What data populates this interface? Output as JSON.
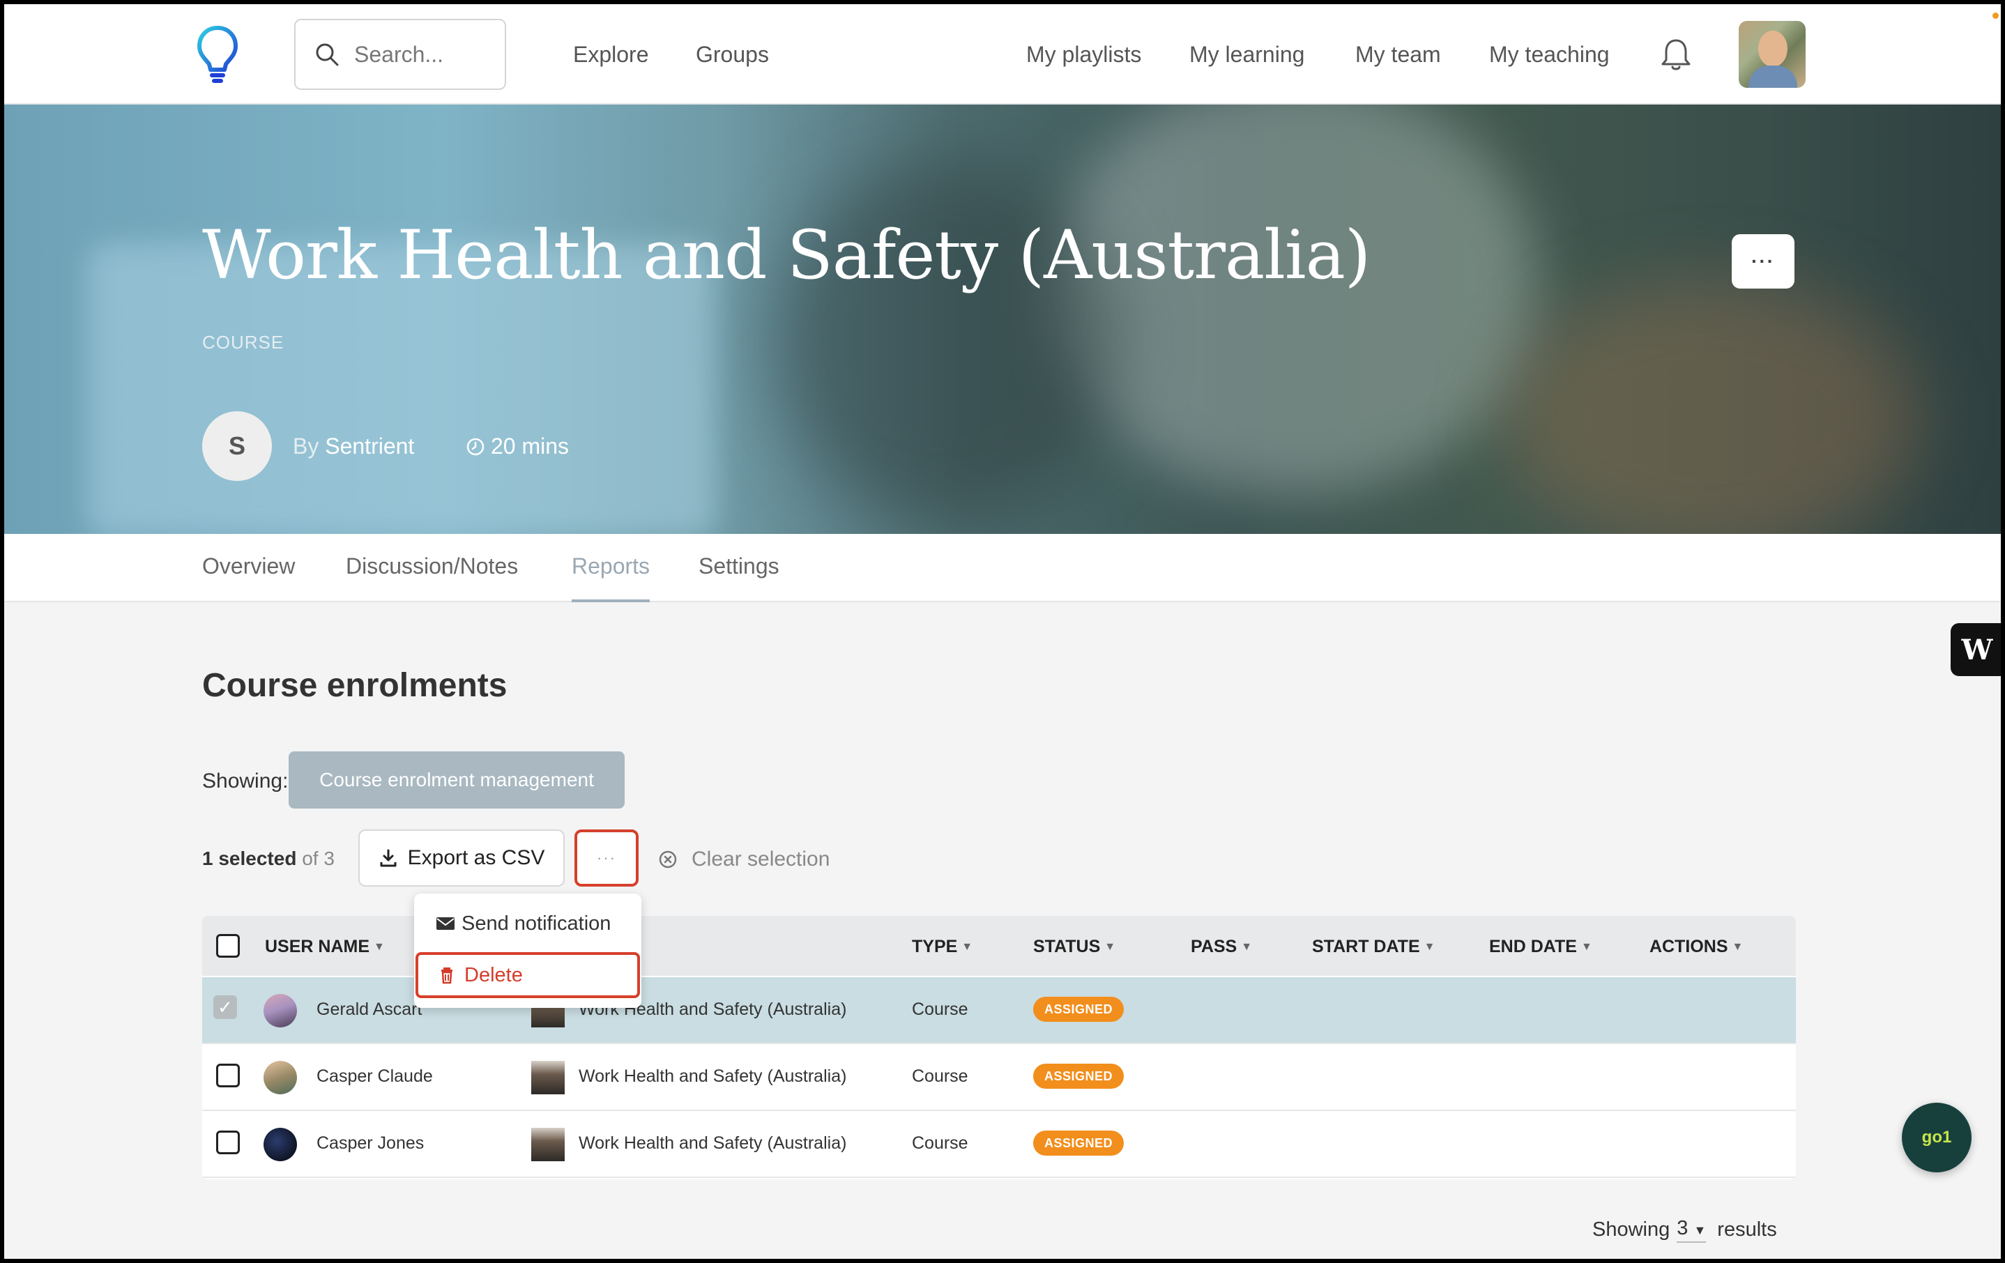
{
  "nav": {
    "search_placeholder": "Search...",
    "links_left": [
      "Explore",
      "Groups"
    ],
    "links_right": [
      "My playlists",
      "My learning",
      "My team",
      "My teaching"
    ]
  },
  "hero": {
    "title": "Work Health and Safety (Australia)",
    "type": "COURSE",
    "author_initial": "S",
    "by_label": "By",
    "author": "Sentrient",
    "duration": "20 mins",
    "more_label": "···"
  },
  "tabs": [
    {
      "label": "Overview",
      "active": false
    },
    {
      "label": "Discussion/Notes",
      "active": false
    },
    {
      "label": "Reports",
      "active": true
    },
    {
      "label": "Settings",
      "active": false
    }
  ],
  "enrolments": {
    "title": "Course enrolments",
    "showing_label": "Showing:",
    "showing_value": "Course enrolment management",
    "selected_count": "1 selected",
    "selected_total": "of 3",
    "export_label": "Export as CSV",
    "more_label": "···",
    "clear_label": "Clear selection"
  },
  "dropdown": {
    "items": [
      {
        "label": "Send notification",
        "icon": "envelope-icon"
      },
      {
        "label": "Delete",
        "icon": "trash-icon"
      }
    ]
  },
  "table": {
    "columns": [
      "USER NAME",
      "TYPE",
      "STATUS",
      "PASS",
      "START DATE",
      "END DATE",
      "ACTIONS"
    ],
    "rows": [
      {
        "user": "Gerald Ascart",
        "course": "Work Health and Safety (Australia)",
        "type": "Course",
        "status": "ASSIGNED",
        "selected": true
      },
      {
        "user": "Casper Claude",
        "course": "Work Health and Safety (Australia)",
        "type": "Course",
        "status": "ASSIGNED",
        "selected": false
      },
      {
        "user": "Casper Jones",
        "course": "Work Health and Safety (Australia)",
        "type": "Course",
        "status": "ASSIGNED",
        "selected": false
      }
    ]
  },
  "footer": {
    "showing_label": "Showing",
    "count": "3",
    "results_label": "results"
  },
  "widgets": {
    "side_badge": "W",
    "go1_label": "go1"
  },
  "colors": {
    "accent_red": "#d6402b",
    "badge_orange": "#f28e1c",
    "selected_row": "#c9dde2",
    "pill_gray": "#a9b8c1"
  }
}
